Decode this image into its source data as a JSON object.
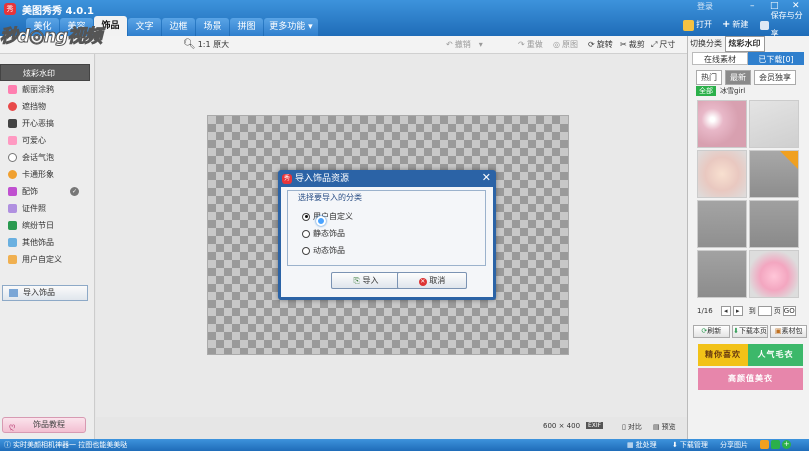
{
  "app": {
    "title": "美图秀秀 4.0.1",
    "login": "登录"
  },
  "tabs": [
    {
      "label": "美化"
    },
    {
      "label": "美容"
    },
    {
      "label": "饰品"
    },
    {
      "label": "文字"
    },
    {
      "label": "边框"
    },
    {
      "label": "场景"
    },
    {
      "label": "拼图"
    },
    {
      "label": "更多功能 ▾"
    }
  ],
  "top_buttons": {
    "open": "打开",
    "new": "新建",
    "save_share": "保存与分享"
  },
  "watermark": "秒d◎ng视频",
  "toolbar": {
    "zoom_original": "1:1 原大",
    "undo": "撤销",
    "redo": "重做",
    "original_image": "原图",
    "rotate": "旋转",
    "crop": "裁剪",
    "size": "尺寸"
  },
  "sidebar": {
    "items": [
      {
        "label": "炫彩水印"
      },
      {
        "label": "靓丽涂鸦"
      },
      {
        "label": "遮挡物"
      },
      {
        "label": "开心恶搞"
      },
      {
        "label": "可爱心"
      },
      {
        "label": "会话气泡"
      },
      {
        "label": "卡通形象"
      },
      {
        "label": "配饰"
      },
      {
        "label": "证件照"
      },
      {
        "label": "缤纷节日"
      },
      {
        "label": "其他饰品"
      },
      {
        "label": "用户自定义"
      }
    ],
    "import_button": "导入饰品",
    "tutorial_button": "饰品教程"
  },
  "dialog": {
    "title": "导入饰品资源",
    "prompt": "选择要导入的分类",
    "options": [
      {
        "label": "用户自定义",
        "selected": true
      },
      {
        "label": "静态饰品",
        "selected": false
      },
      {
        "label": "动态饰品",
        "selected": false
      }
    ],
    "import_button": "导入",
    "cancel_button": "取消"
  },
  "canvas_info": {
    "size": "600 × 400",
    "compare": "对比",
    "preview": "预览"
  },
  "right_panel": {
    "switch_category_label": "切换分类",
    "current_category": "炫彩水印",
    "tabs": [
      {
        "label": "在线素材"
      },
      {
        "label": "已下载[0]"
      }
    ],
    "subtabs": [
      {
        "label": "热门"
      },
      {
        "label": "最新"
      },
      {
        "label": "会员独享"
      }
    ],
    "filter_all": "全部",
    "filter_tag": "冰雪girl",
    "pager": {
      "page": "1/16",
      "to": "到",
      "page_unit": "页",
      "go": "GO"
    },
    "actions": [
      {
        "label": "刷新"
      },
      {
        "label": "下载本页"
      },
      {
        "label": "素材包"
      }
    ],
    "banners": [
      {
        "label": "精你喜欢"
      },
      {
        "label": "人气毛衣"
      },
      {
        "label": "高颜值美衣"
      }
    ]
  },
  "bottombar": {
    "tip": "实时美颜相机神器一 拉图也能美美哒",
    "batch": "批处理",
    "download_manager": "下载管理",
    "share_pic": "分享图片"
  }
}
